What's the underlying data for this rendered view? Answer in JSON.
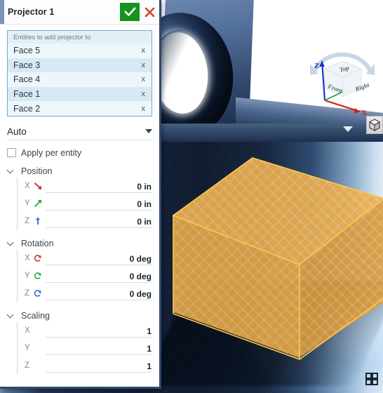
{
  "panel": {
    "title": "Projector 1",
    "confirm_icon": "check-icon",
    "cancel_icon": "close-icon",
    "entities": {
      "header": "Entities to add projector to",
      "remove_label": "x",
      "items": [
        {
          "label": "Face 5"
        },
        {
          "label": "Face 3"
        },
        {
          "label": "Face 4"
        },
        {
          "label": "Face 1"
        },
        {
          "label": "Face 2"
        }
      ]
    },
    "mode_dropdown": {
      "value": "Auto",
      "caret_icon": "chevron-down-icon"
    },
    "apply_per_entity": {
      "label": "Apply per entity",
      "checked": false
    },
    "sections": [
      {
        "title": "Position",
        "expanded": true,
        "fields": [
          {
            "axis": "X",
            "value": "0 in",
            "icon": "arrow-x-icon",
            "color": "#cc2b2b"
          },
          {
            "axis": "Y",
            "value": "0 in",
            "icon": "arrow-y-icon",
            "color": "#1faa3c"
          },
          {
            "axis": "Z",
            "value": "0 in",
            "icon": "arrow-z-icon",
            "color": "#2f6fd0"
          }
        ]
      },
      {
        "title": "Rotation",
        "expanded": true,
        "fields": [
          {
            "axis": "X",
            "value": "0 deg",
            "icon": "rotate-x-icon",
            "color": "#cc2b2b"
          },
          {
            "axis": "Y",
            "value": "0 deg",
            "icon": "rotate-y-icon",
            "color": "#1faa3c"
          },
          {
            "axis": "Z",
            "value": "0 deg",
            "icon": "rotate-z-icon",
            "color": "#2f6fd0"
          }
        ]
      },
      {
        "title": "Scaling",
        "expanded": true,
        "fields": [
          {
            "axis": "X",
            "value": "1",
            "icon": "",
            "color": ""
          },
          {
            "axis": "Y",
            "value": "1",
            "icon": "",
            "color": ""
          },
          {
            "axis": "Z",
            "value": "1",
            "icon": "",
            "color": ""
          }
        ]
      }
    ]
  },
  "viewport": {
    "nav_cube": {
      "faces": [
        {
          "label": "Top"
        },
        {
          "label": "Front"
        },
        {
          "label": "Right"
        }
      ],
      "axes": [
        {
          "label": "Z",
          "color": "#1a35c9"
        },
        {
          "label": "X",
          "color": "#d11b1b"
        }
      ]
    },
    "view_cube_button_icon": "cube-icon",
    "view_dropdown_icon": "triangle-down-icon",
    "fullscreen_icon": "fullscreen-icon"
  },
  "colors": {
    "accent_green": "#15931f",
    "accent_red": "#d4422a",
    "panel_border": "#2b4a72",
    "entity_border": "#7ba7ce",
    "cube_orange": "#eaad4e"
  }
}
